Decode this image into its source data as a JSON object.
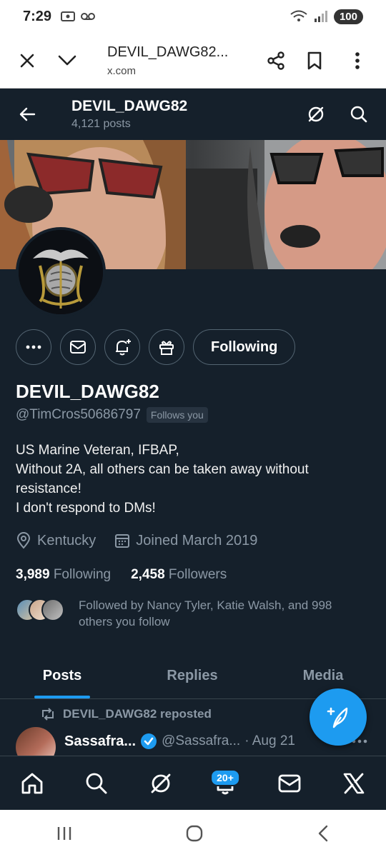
{
  "status_bar": {
    "time": "7:29",
    "battery": "100"
  },
  "browser": {
    "page_title": "DEVIL_DAWG82...",
    "url": "x.com"
  },
  "header": {
    "name": "DEVIL_DAWG82",
    "posts_count": "4,121 posts"
  },
  "profile": {
    "display_name": "DEVIL_DAWG82",
    "handle": "@TimCros50686797",
    "follows_you": "Follows you",
    "following_button": "Following",
    "bio": [
      "US Marine Veteran, IFBAP,",
      "Without 2A, all others can be taken away without",
      "resistance!",
      "I don't respond to DMs!"
    ],
    "location": "Kentucky",
    "joined": "Joined March 2019",
    "following_count": "3,989",
    "following_label": "Following",
    "followers_count": "2,458",
    "followers_label": "Followers",
    "followed_by": "Followed by Nancy Tyler, Katie Walsh, and 998 others you follow"
  },
  "tabs": [
    {
      "label": "Posts",
      "active": true
    },
    {
      "label": "Replies",
      "active": false
    },
    {
      "label": "Media",
      "active": false
    }
  ],
  "feed": {
    "repost_label": "DEVIL_DAWG82 reposted",
    "tweet": {
      "author": "Sassafra...",
      "handle": "@Sassafra...",
      "date": "· Aug 21"
    }
  },
  "bottom_nav": {
    "notifications_badge": "20+"
  },
  "colors": {
    "background": "#15202b",
    "accent": "#1d9bf0",
    "muted": "#8b98a5",
    "border": "#38444d"
  },
  "icons": [
    "close-icon",
    "chevron-down-icon",
    "share-icon",
    "bookmark-icon",
    "more-vert-icon",
    "back-arrow-icon",
    "grok-icon",
    "search-icon",
    "more-icon",
    "mail-icon",
    "bell-plus-icon",
    "gift-icon",
    "location-icon",
    "calendar-icon",
    "retweet-icon",
    "verified-icon",
    "compose-icon",
    "home-icon",
    "notifications-icon",
    "x-logo-icon"
  ]
}
